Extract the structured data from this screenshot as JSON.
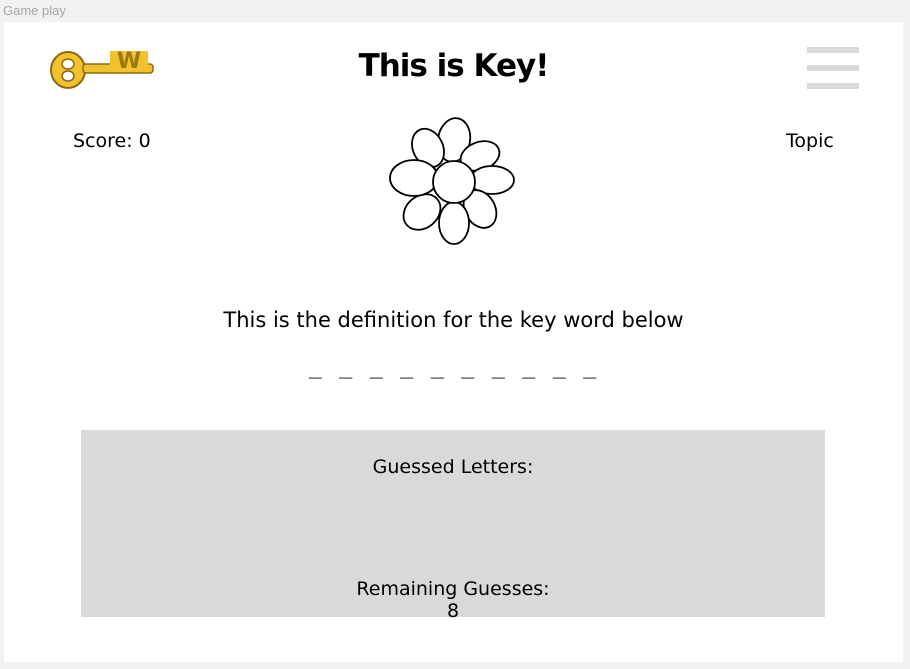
{
  "window": {
    "title": "Game play"
  },
  "header": {
    "title": "This is Key!",
    "logo_letter": "W",
    "menu_icon": "hamburger-menu-icon"
  },
  "score": {
    "text": "Score: 0"
  },
  "topic": {
    "label": "Topic"
  },
  "game": {
    "definition": "This is the definition for the key word below",
    "blanks": "_ _ _ _ _ _ _ _ _ _",
    "picture_icon": "flower-icon"
  },
  "guesses": {
    "guessed_label": "Guessed Letters:",
    "guessed_letters": "",
    "remaining_label": "Remaining Guesses:",
    "remaining_count": "8"
  },
  "colors": {
    "panel": "#d9d9d9",
    "key_gold": "#f2c12e",
    "menu_bar": "#d9d9d9"
  }
}
